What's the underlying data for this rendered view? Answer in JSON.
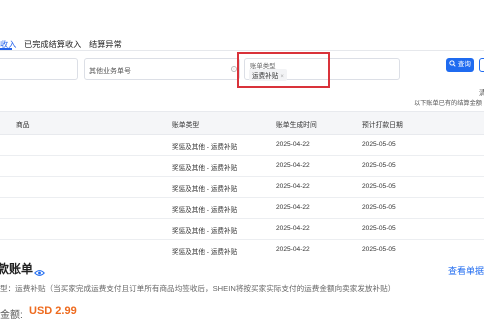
{
  "tabs": [
    {
      "label": "收入",
      "active": true
    },
    {
      "label": "已完成结算收入",
      "active": false
    },
    {
      "label": "结算异常",
      "active": false
    }
  ],
  "filters": {
    "other_business_no_placeholder": "其他业务单号",
    "bill_type_label": "账单类型",
    "bill_type_selected": "运费补贴",
    "chip_close": "×"
  },
  "buttons": {
    "query_label": "查询",
    "query_icon": "search-icon"
  },
  "note": {
    "right_char": "清",
    "text": "以下账单已有的结算金额"
  },
  "table": {
    "headers": [
      "商品",
      "账单类型",
      "账单生成时间",
      "预计打款日期"
    ],
    "rows": [
      [
        "奖惩及其他 - 运费补贴",
        "2025-04-22",
        "2025-05-05"
      ],
      [
        "奖惩及其他 - 运费补贴",
        "2025-04-22",
        "2025-05-05"
      ],
      [
        "奖惩及其他 - 运费补贴",
        "2025-04-22",
        "2025-05-05"
      ],
      [
        "奖惩及其他 - 运费补贴",
        "2025-04-22",
        "2025-05-05"
      ],
      [
        "奖惩及其他 - 运费补贴",
        "2025-04-22",
        "2025-05-05"
      ],
      [
        "奖惩及其他 - 运费补贴",
        "2025-04-22",
        "2025-05-05"
      ]
    ]
  },
  "summary": {
    "title": "款账单",
    "view_link": "查看单据",
    "description": "型：运费补贴（当买家完成运费支付且订单所有商品均签收后，SHEIN将按买家实际支付的运费金额向卖家发放补贴）",
    "amount_label": "金额:",
    "amount_value": "USD 2.99"
  },
  "colors": {
    "accent": "#1f6bf0",
    "highlight_box": "#d9323a",
    "amount": "#ee6b1f"
  }
}
